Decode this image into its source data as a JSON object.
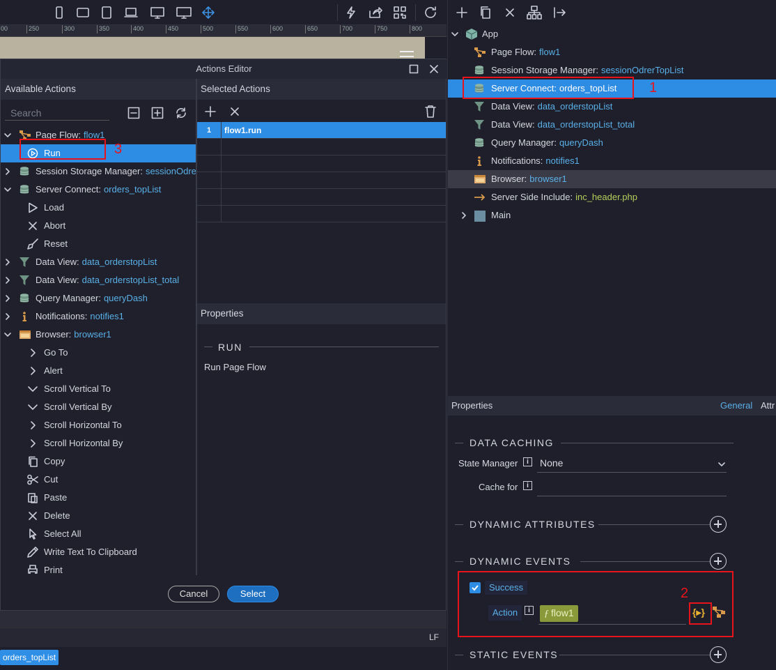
{
  "toolbar_left": {
    "icons": [
      "phone-icon",
      "tablet-landscape-icon",
      "tablet-icon",
      "laptop-icon",
      "desktop-icon",
      "wide-desktop-icon",
      "move-icon",
      "lightning-icon",
      "share-icon",
      "qr-code-icon",
      "refresh-icon"
    ]
  },
  "ruler": {
    "ticks": [
      "00",
      "250",
      "300",
      "350",
      "400",
      "450",
      "500",
      "550",
      "600",
      "650",
      "700",
      "750",
      "800"
    ]
  },
  "dialog": {
    "title": "Actions Editor",
    "available_title": "Available Actions",
    "selected_title": "Selected Actions",
    "search_placeholder": "Search",
    "tree": [
      {
        "label": "Page Flow:",
        "value": "flow1",
        "level": 0,
        "expanded": true,
        "icon": "flow-icon"
      },
      {
        "label": "Run",
        "value": "",
        "level": 1,
        "icon": "play-circle-icon",
        "selected": true
      },
      {
        "label": "Session Storage Manager:",
        "value": "sessionOdre",
        "level": 0,
        "expanded": false,
        "icon": "database-icon"
      },
      {
        "label": "Server Connect:",
        "value": "orders_topList",
        "level": 0,
        "expanded": true,
        "icon": "database-icon"
      },
      {
        "label": "Load",
        "value": "",
        "level": 1,
        "icon": "play-icon"
      },
      {
        "label": "Abort",
        "value": "",
        "level": 1,
        "icon": "x-icon"
      },
      {
        "label": "Reset",
        "value": "",
        "level": 1,
        "icon": "broom-icon"
      },
      {
        "label": "Data View:",
        "value": "data_orderstopList",
        "level": 0,
        "expanded": false,
        "icon": "filter-icon"
      },
      {
        "label": "Data View:",
        "value": "data_orderstopList_total",
        "level": 0,
        "expanded": false,
        "icon": "filter-icon"
      },
      {
        "label": "Query Manager:",
        "value": "queryDash",
        "level": 0,
        "expanded": false,
        "icon": "database-icon"
      },
      {
        "label": "Notifications:",
        "value": "notifies1",
        "level": 0,
        "expanded": false,
        "icon": "info-icon"
      },
      {
        "label": "Browser:",
        "value": "browser1",
        "level": 0,
        "expanded": true,
        "icon": "browser-icon"
      },
      {
        "label": "Go To",
        "value": "",
        "level": 1,
        "icon": "chevron-right-icon"
      },
      {
        "label": "Alert",
        "value": "",
        "level": 1,
        "icon": "chevron-right-icon"
      },
      {
        "label": "Scroll Vertical To",
        "value": "",
        "level": 1,
        "icon": "chevron-down-icon"
      },
      {
        "label": "Scroll Vertical By",
        "value": "",
        "level": 1,
        "icon": "chevron-down-icon"
      },
      {
        "label": "Scroll Horizontal To",
        "value": "",
        "level": 1,
        "icon": "chevron-right-icon"
      },
      {
        "label": "Scroll Horizontal By",
        "value": "",
        "level": 1,
        "icon": "chevron-right-icon"
      },
      {
        "label": "Copy",
        "value": "",
        "level": 1,
        "icon": "copy-icon"
      },
      {
        "label": "Cut",
        "value": "",
        "level": 1,
        "icon": "scissors-icon"
      },
      {
        "label": "Paste",
        "value": "",
        "level": 1,
        "icon": "paste-icon"
      },
      {
        "label": "Delete",
        "value": "",
        "level": 1,
        "icon": "x-icon"
      },
      {
        "label": "Select All",
        "value": "",
        "level": 1,
        "icon": "cursor-icon"
      },
      {
        "label": "Write Text To Clipboard",
        "value": "",
        "level": 1,
        "icon": "pen-icon"
      },
      {
        "label": "Print",
        "value": "",
        "level": 1,
        "icon": "printer-icon"
      }
    ],
    "selected_actions": [
      {
        "num": "1",
        "value": "flow1.run"
      },
      {
        "num": "",
        "value": ""
      },
      {
        "num": "",
        "value": ""
      },
      {
        "num": "",
        "value": ""
      },
      {
        "num": "",
        "value": ""
      },
      {
        "num": "",
        "value": ""
      }
    ],
    "properties_title": "Properties",
    "run_heading": "RUN",
    "run_description": "Run Page Flow",
    "cancel_label": "Cancel",
    "select_label": "Select"
  },
  "bottom": {
    "lf_label": "LF",
    "breadcrumb": "orders_topList"
  },
  "app_tree": {
    "root": "App",
    "items": [
      {
        "label": "Page Flow:",
        "value": "flow1",
        "icon": "flow-icon",
        "value_color": "blue"
      },
      {
        "label": "Session Storage Manager:",
        "value": "sessionOdrerTopList",
        "icon": "database-icon",
        "value_color": "blue"
      },
      {
        "label": "Server Connect:",
        "value": "orders_topList",
        "icon": "database-icon",
        "value_color": "white",
        "selected": true
      },
      {
        "label": "Data View:",
        "value": "data_orderstopList",
        "icon": "filter-icon",
        "value_color": "blue"
      },
      {
        "label": "Data View:",
        "value": "data_orderstopList_total",
        "icon": "filter-icon",
        "value_color": "blue"
      },
      {
        "label": "Query Manager:",
        "value": "queryDash",
        "icon": "database-icon",
        "value_color": "blue"
      },
      {
        "label": "Notifications:",
        "value": "notifies1",
        "icon": "info-icon",
        "value_color": "blue"
      },
      {
        "label": "Browser:",
        "value": "browser1",
        "icon": "browser-icon",
        "value_color": "blue",
        "hover": true
      },
      {
        "label": "Server Side Include:",
        "value": "inc_header.php",
        "icon": "arrow-right-icon",
        "value_color": "green"
      },
      {
        "label": "Main",
        "value": "",
        "icon": "square-icon",
        "value_color": "blue",
        "collapsible": true
      }
    ]
  },
  "right_props": {
    "title": "Properties",
    "tab_general": "General",
    "tab_attr": "Attr",
    "data_caching": "DATA CACHING",
    "state_manager_label": "State Manager",
    "state_manager_value": "None",
    "cache_for_label": "Cache for",
    "dynamic_attributes": "DYNAMIC ATTRIBUTES",
    "dynamic_events": "DYNAMIC EVENTS",
    "success_label": "Success",
    "action_label": "Action",
    "action_value": "flow1",
    "static_events": "STATIC EVENTS"
  },
  "annotations": {
    "n1": "1",
    "n2": "2",
    "n3": "3",
    "color": "#e8141c"
  },
  "colors": {
    "accent": "#2d8ce4",
    "value_blue": "#5ab0e8",
    "value_green": "#b7cf5a",
    "annotation_red": "#e8141c"
  }
}
